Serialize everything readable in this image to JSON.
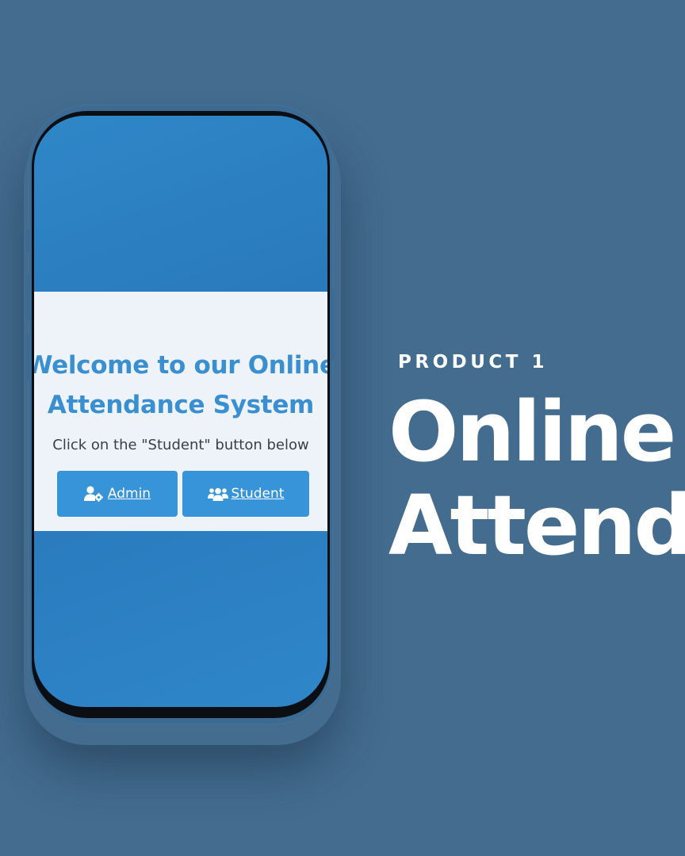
{
  "promo": {
    "kicker": "PRODUCT 1",
    "headline": "Online\nAttenda"
  },
  "app": {
    "welcome": "Welcome to our Online\nAttendance System",
    "instruction": "Click on the \"Student\" button below",
    "buttons": {
      "admin": {
        "label": " Admin",
        "icon": "user-gear-icon"
      },
      "student": {
        "label": " Student",
        "icon": "users-icon"
      }
    }
  },
  "colors": {
    "background": "#436c8f",
    "screen": "#2f87c8",
    "card": "#edf3f9",
    "heading": "#3a8fd1",
    "button": "#3794d8",
    "button_text": "#ffffff",
    "promo_text": "#ffffff"
  }
}
